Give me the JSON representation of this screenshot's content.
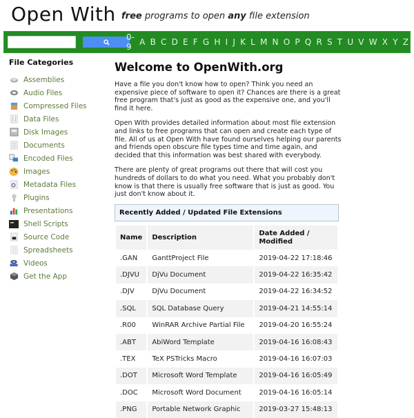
{
  "header": {
    "logo": "Open With",
    "tagline": {
      "part1": "free",
      "part2": " programs to open ",
      "part3": "any",
      "part4": " file extension"
    }
  },
  "navbar": {
    "search_placeholder": "",
    "search_value": "",
    "search_icon": "search-icon",
    "letters": [
      "0-9",
      "A",
      "B",
      "C",
      "D",
      "E",
      "F",
      "G",
      "H",
      "I",
      "J",
      "K",
      "L",
      "M",
      "N",
      "O",
      "P",
      "Q",
      "R",
      "S",
      "T",
      "U",
      "V",
      "W",
      "X",
      "Y",
      "Z"
    ],
    "colors": {
      "bar": "#228b22",
      "button": "#4d8ef5"
    }
  },
  "sidebar": {
    "title": "File Categories",
    "items": [
      {
        "label": "Assemblies",
        "icon": "gear-icon"
      },
      {
        "label": "Audio Files",
        "icon": "disc-icon"
      },
      {
        "label": "Compressed Files",
        "icon": "box-icon"
      },
      {
        "label": "Data Files",
        "icon": "data-file-icon"
      },
      {
        "label": "Disk Images",
        "icon": "disk-image-icon"
      },
      {
        "label": "Documents",
        "icon": "document-icon"
      },
      {
        "label": "Encoded Files",
        "icon": "encoded-file-icon"
      },
      {
        "label": "Images",
        "icon": "palette-icon"
      },
      {
        "label": "Metadata Files",
        "icon": "metadata-icon"
      },
      {
        "label": "Plugins",
        "icon": "plugin-icon"
      },
      {
        "label": "Presentations",
        "icon": "chart-icon"
      },
      {
        "label": "Shell Scripts",
        "icon": "terminal-icon"
      },
      {
        "label": "Source Code",
        "icon": "source-code-icon"
      },
      {
        "label": "Spreadsheets",
        "icon": "spreadsheet-icon"
      },
      {
        "label": "Videos",
        "icon": "video-icon"
      },
      {
        "label": "Get the App",
        "icon": "app-icon"
      }
    ]
  },
  "main": {
    "title": "Welcome to OpenWith.org",
    "paragraphs": [
      "Have a file you don't know how to open? Think you need an expensive piece of software to open it? Chances are there is a great free program that's just as good as the expensive one, and you'll find it here.",
      "Open With provides detailed information about most file extension and links to free programs that can open and create each type of file. All of us at Open With have found ourselves helping our parents and friends open obscure file types time and time again, and decided that this information was best shared with everybody.",
      "There are plenty of great programs out there that will cost you hundreds of dollars to do what you need. What you probably don't know is that there is usually free software that is just as good. You just don't know about it."
    ],
    "recent_title": "Recently Added / Updated File Extensions",
    "table": {
      "headers": [
        "Name",
        "Description",
        "Date Added / Modified"
      ],
      "rows": [
        {
          "name": ".GAN",
          "desc": "GanttProject File",
          "date": "2019-04-22 17:18:46"
        },
        {
          "name": ".DJVU",
          "desc": "DjVu Document",
          "date": "2019-04-22 16:35:42"
        },
        {
          "name": ".DJV",
          "desc": "DjVu Document",
          "date": "2019-04-22 16:34:52"
        },
        {
          "name": ".SQL",
          "desc": "SQL Database Query",
          "date": "2019-04-21 14:55:14"
        },
        {
          "name": ".R00",
          "desc": "WinRAR Archive Partial File",
          "date": "2019-04-20 16:55:24"
        },
        {
          "name": ".ABT",
          "desc": "AbiWord Template",
          "date": "2019-04-16 16:08:43"
        },
        {
          "name": ".TEX",
          "desc": "TeX PSTricks Macro",
          "date": "2019-04-16 16:07:03"
        },
        {
          "name": ".DOT",
          "desc": "Microsoft Word Template",
          "date": "2019-04-16 16:05:49"
        },
        {
          "name": ".DOC",
          "desc": "Microsoft Word Document",
          "date": "2019-04-16 16:05:14"
        },
        {
          "name": ".PNG",
          "desc": "Portable Network Graphic",
          "date": "2019-03-27 15:48:13"
        }
      ]
    }
  }
}
